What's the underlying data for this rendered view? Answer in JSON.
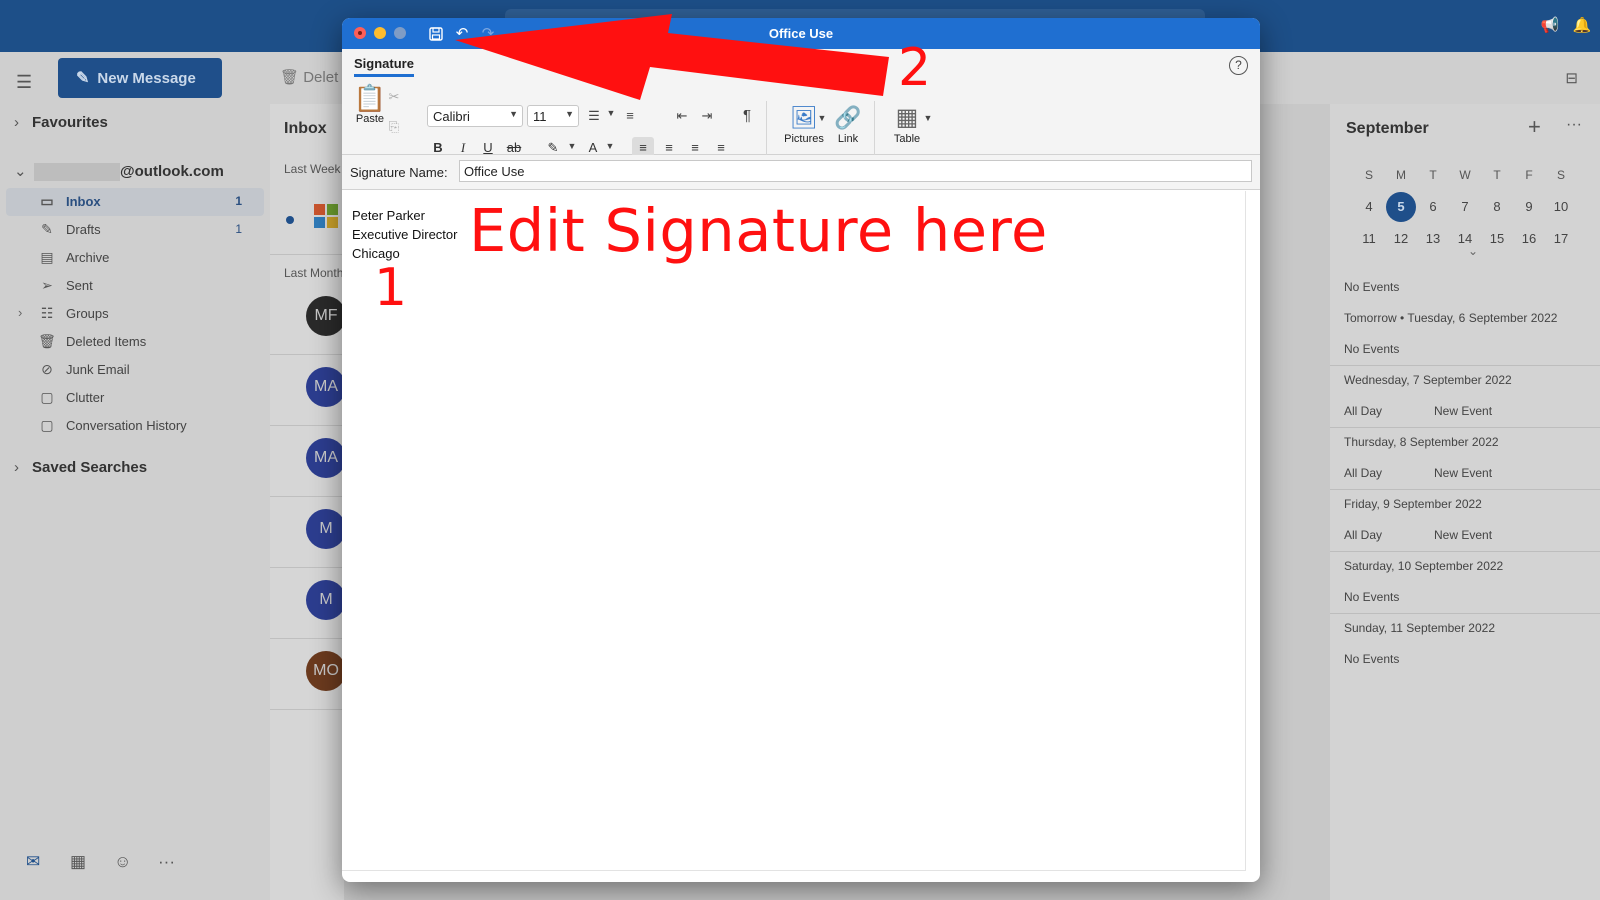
{
  "colors": {
    "accent": "#1f6fd1",
    "nav_blue": "#1f4f8a",
    "annotation": "#ff1010"
  },
  "background": {
    "new_message": "New Message",
    "delete_label": "Delet",
    "favourites": "Favourites",
    "account_suffix": "@outlook.com",
    "folders": [
      {
        "label": "Inbox",
        "count": "1",
        "icon": "inbox-icon"
      },
      {
        "label": "Drafts",
        "count": "1",
        "icon": "pencil-icon"
      },
      {
        "label": "Archive",
        "count": "",
        "icon": "archive-icon"
      },
      {
        "label": "Sent",
        "count": "",
        "icon": "send-icon"
      },
      {
        "label": "Groups",
        "count": "",
        "icon": "groups-icon"
      },
      {
        "label": "Deleted Items",
        "count": "",
        "icon": "trash-icon"
      },
      {
        "label": "Junk Email",
        "count": "",
        "icon": "junk-icon"
      },
      {
        "label": "Clutter",
        "count": "",
        "icon": "folder-icon"
      },
      {
        "label": "Conversation History",
        "count": "",
        "icon": "folder-icon"
      }
    ],
    "saved_searches": "Saved Searches",
    "list": {
      "title": "Inbox",
      "groups": [
        "Last Week",
        "Last Month"
      ],
      "avatars": [
        {
          "initials": "MF",
          "color": "#2a2a2a"
        },
        {
          "initials": "MA",
          "color": "#2c3d8f"
        },
        {
          "initials": "MA",
          "color": "#2c3d8f"
        },
        {
          "initials": "M",
          "color": "#2c3d8f"
        },
        {
          "initials": "M",
          "color": "#2c3d8f"
        },
        {
          "initials": "MO",
          "color": "#6b3a1e"
        }
      ]
    },
    "calendar": {
      "month": "September",
      "weekdays": [
        "S",
        "M",
        "T",
        "W",
        "T",
        "F",
        "S"
      ],
      "weeks": [
        [
          "4",
          "5",
          "6",
          "7",
          "8",
          "9",
          "10"
        ],
        [
          "11",
          "12",
          "13",
          "14",
          "15",
          "16",
          "17"
        ]
      ],
      "today": "5",
      "events": [
        {
          "label": "No Events",
          "type": "text"
        },
        {
          "label": "Tomorrow • Tuesday, 6 September 2022",
          "type": "header"
        },
        {
          "label": "No Events",
          "type": "text"
        },
        {
          "label": "Wednesday, 7 September 2022",
          "type": "header"
        },
        {
          "label": "All Day",
          "new": "New Event",
          "type": "allday"
        },
        {
          "label": "Thursday, 8 September 2022",
          "type": "header"
        },
        {
          "label": "All Day",
          "new": "New Event",
          "type": "allday"
        },
        {
          "label": "Friday, 9 September 2022",
          "type": "header"
        },
        {
          "label": "All Day",
          "new": "New Event",
          "type": "allday"
        },
        {
          "label": "Saturday, 10 September 2022",
          "type": "header"
        },
        {
          "label": "No Events",
          "type": "text"
        },
        {
          "label": "Sunday, 11 September 2022",
          "type": "header"
        },
        {
          "label": "No Events",
          "type": "text"
        }
      ]
    }
  },
  "dialog": {
    "title": "Office Use",
    "tab": "Signature",
    "help": "?",
    "ribbon": {
      "paste": "Paste",
      "font_name": "Calibri",
      "font_size": "11",
      "bold": "B",
      "italic": "I",
      "underline": "U",
      "strike": "ab",
      "pilcrow": "¶",
      "pictures": "Pictures",
      "link": "Link",
      "table": "Table"
    },
    "signature_name_label": "Signature Name:",
    "signature_name_value": "Office Use",
    "signature_lines": [
      "Peter Parker",
      "Executive Director",
      "Chicago"
    ]
  },
  "annotations": {
    "headline": "Edit Signature here",
    "step1": "1",
    "step2": "2"
  }
}
